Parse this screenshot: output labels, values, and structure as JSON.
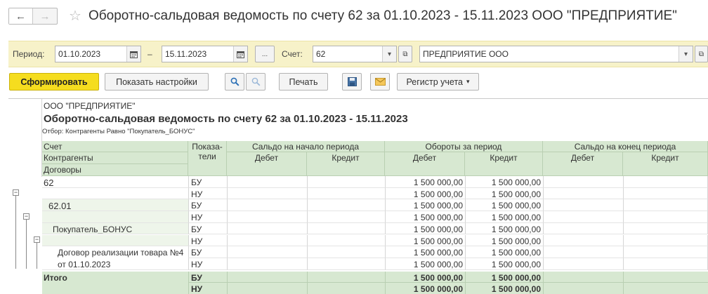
{
  "window": {
    "title": "Оборотно-сальдовая ведомость по счету 62 за 01.10.2023 - 15.11.2023 ООО \"ПРЕДПРИЯТИЕ\""
  },
  "filters": {
    "period_label": "Период:",
    "date_from": "01.10.2023",
    "dash": "–",
    "date_to": "15.11.2023",
    "more_label": "...",
    "account_label": "Счет:",
    "account_value": "62",
    "organization_value": "ПРЕДПРИЯТИЕ ООО"
  },
  "toolbar": {
    "generate_label": "Сформировать",
    "settings_label": "Показать настройки",
    "print_label": "Печать",
    "register_label": "Регистр учета"
  },
  "report": {
    "org": "ООО \"ПРЕДПРИЯТИЕ\"",
    "title": "Оборотно-сальдовая ведомость по счету 62 за 01.10.2023 - 15.11.2023",
    "filter": "Отбор: Контрагенты Равно \"Покупатель_БОНУС\"",
    "headers": {
      "account": "Счет",
      "counterparties": "Контрагенты",
      "contracts": "Договоры",
      "indicators_line1": "Показа-",
      "indicators_line2": "тели",
      "opening": "Сальдо на начало периода",
      "turnover": "Обороты за период",
      "closing": "Сальдо на конец периода",
      "debit": "Дебет",
      "credit": "Кредит"
    },
    "rows": [
      {
        "name": "62",
        "indicator": "БУ",
        "t_debit": "1 500 000,00",
        "t_credit": "1 500 000,00"
      },
      {
        "name": "",
        "indicator": "НУ",
        "t_debit": "1 500 000,00",
        "t_credit": "1 500 000,00"
      },
      {
        "name": "62.01",
        "indicator": "БУ",
        "t_debit": "1 500 000,00",
        "t_credit": "1 500 000,00"
      },
      {
        "name": "",
        "indicator": "НУ",
        "t_debit": "1 500 000,00",
        "t_credit": "1 500 000,00"
      },
      {
        "name": "Покупатель_БОНУС",
        "indicator": "БУ",
        "t_debit": "1 500 000,00",
        "t_credit": "1 500 000,00"
      },
      {
        "name": "",
        "indicator": "НУ",
        "t_debit": "1 500 000,00",
        "t_credit": "1 500 000,00"
      },
      {
        "name": "Договор реализации товара №4",
        "indicator": "БУ",
        "t_debit": "1 500 000,00",
        "t_credit": "1 500 000,00"
      },
      {
        "name": "от 01.10.2023",
        "indicator": "НУ",
        "t_debit": "1 500 000,00",
        "t_credit": "1 500 000,00"
      }
    ],
    "total": {
      "label": "Итого",
      "rows": [
        {
          "indicator": "БУ",
          "t_debit": "1 500 000,00",
          "t_credit": "1 500 000,00"
        },
        {
          "indicator": "НУ",
          "t_debit": "1 500 000,00",
          "t_credit": "1 500 000,00"
        }
      ]
    }
  },
  "colors": {
    "accent": "#f5dd1f",
    "filter_bg": "#f7f2c9",
    "header_bg": "#d7e8d1"
  }
}
